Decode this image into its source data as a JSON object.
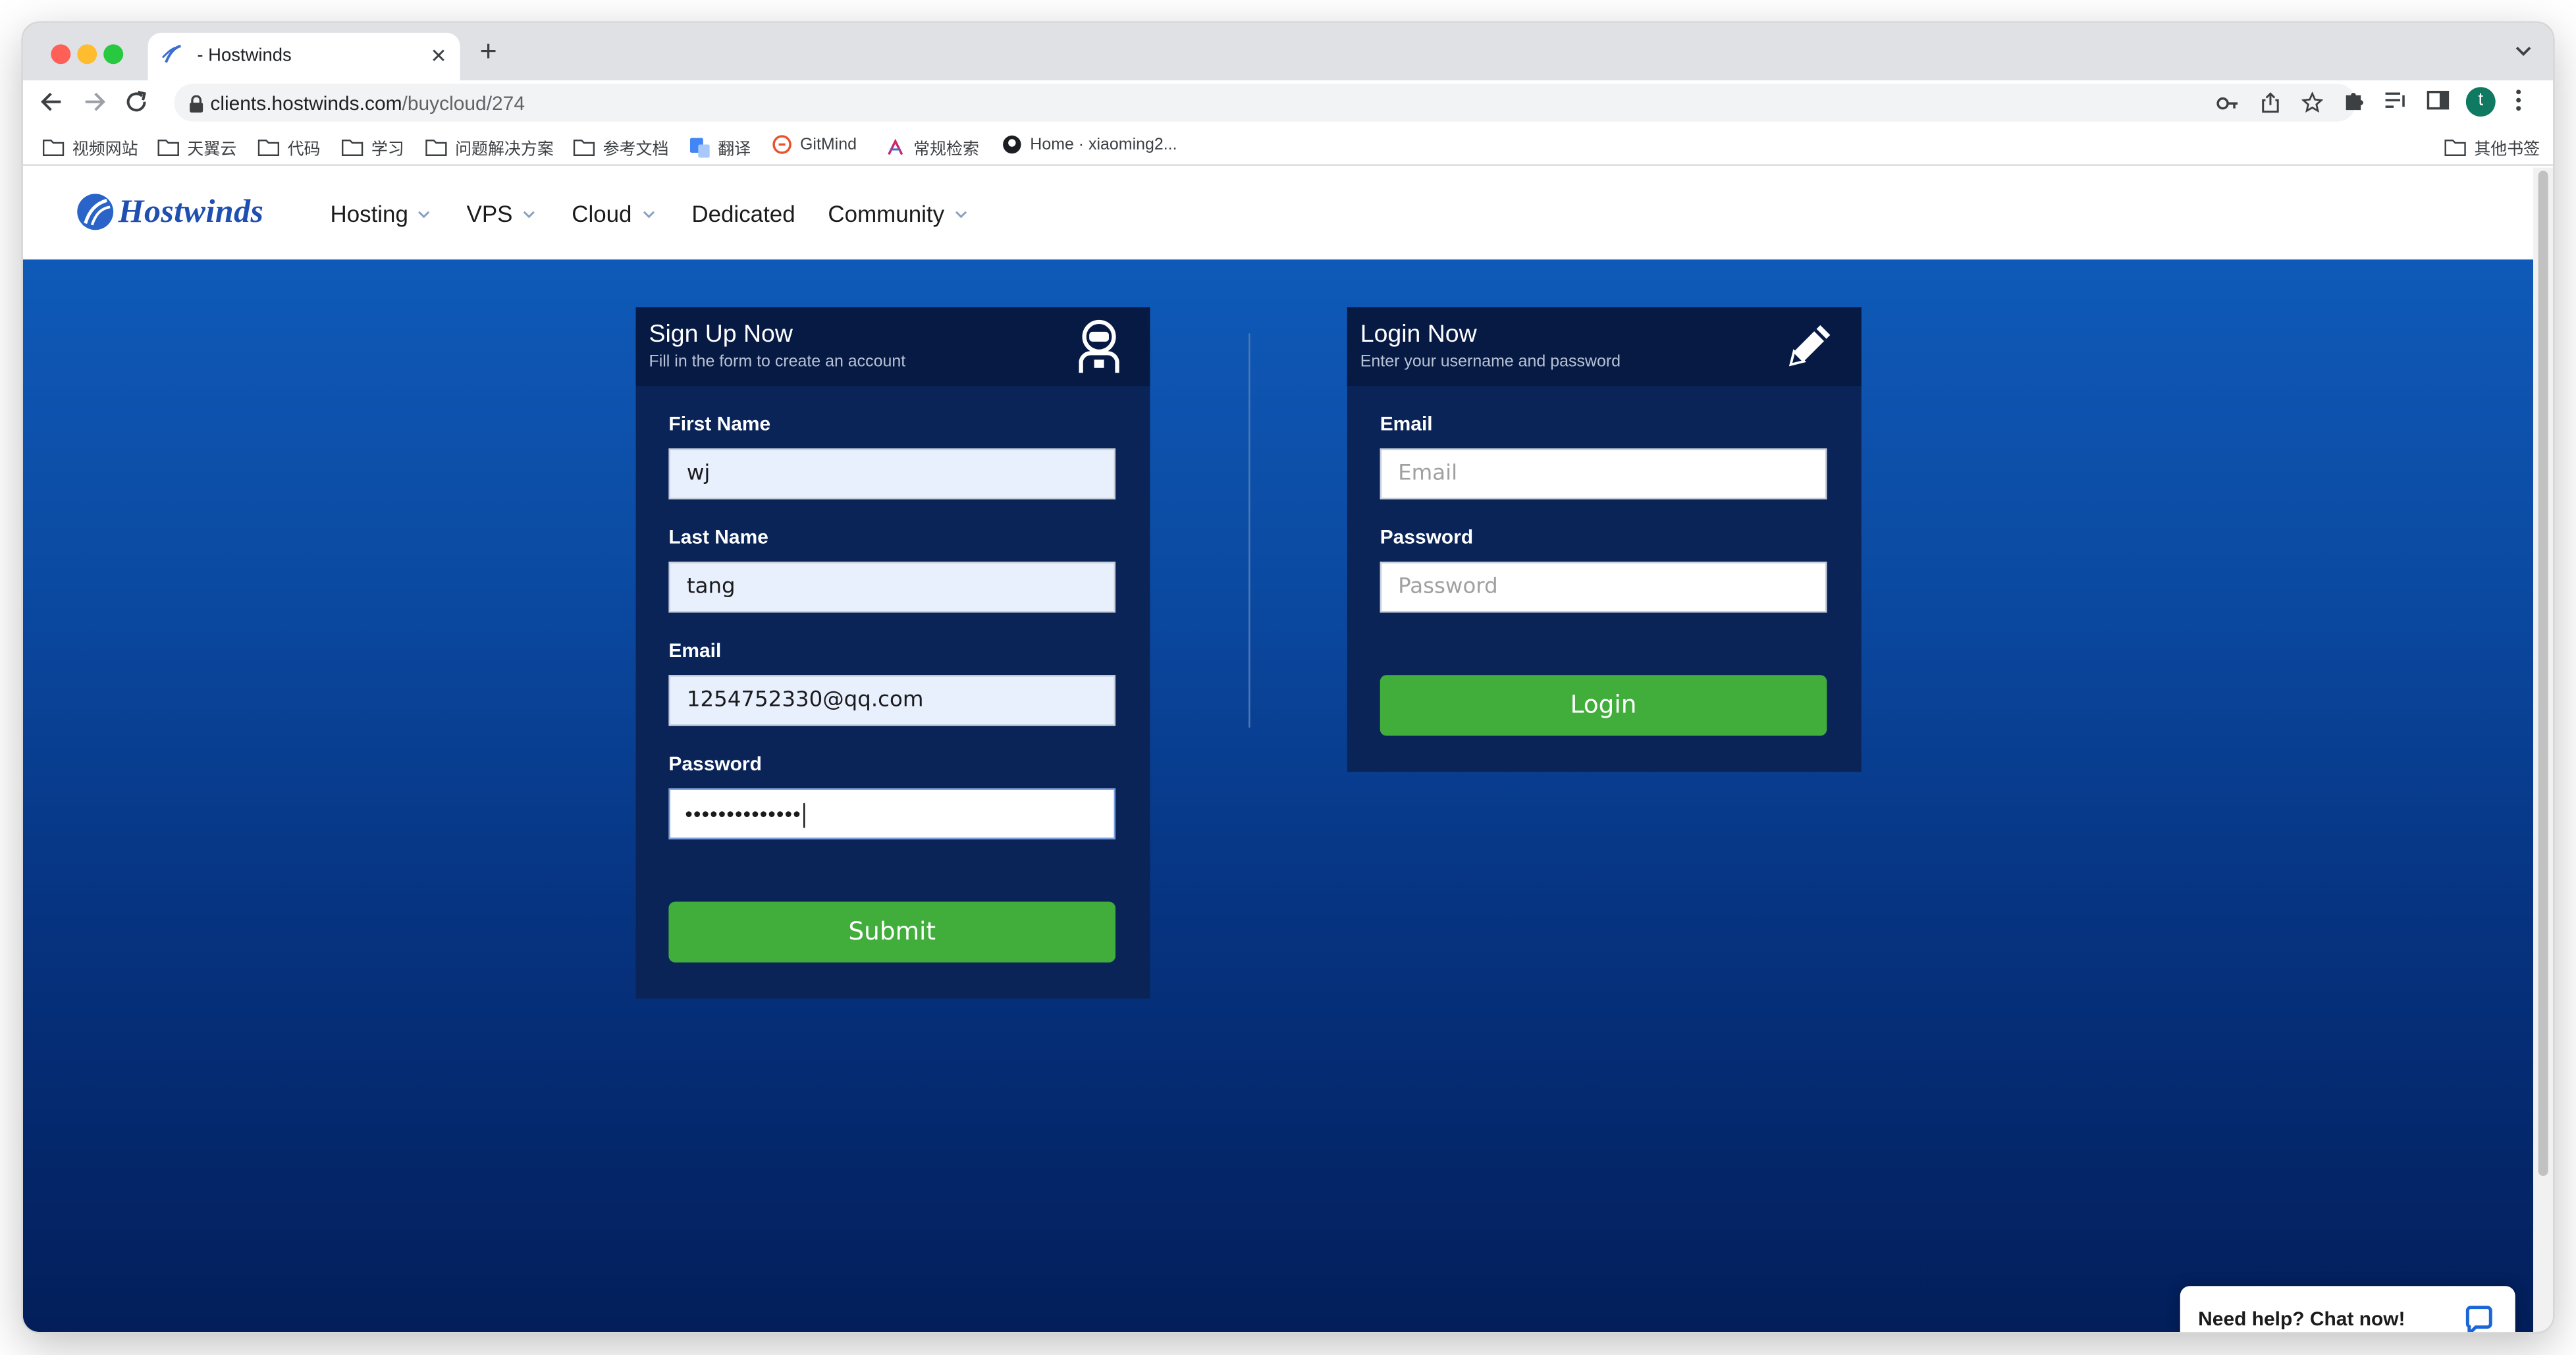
{
  "browser": {
    "tab_title": "- Hostwinds",
    "url_host": "clients.hostwinds.com",
    "url_path": "/buycloud/274",
    "profile_initial": "t",
    "bookmarks": [
      {
        "label": "视频网站",
        "icon": "folder-icon"
      },
      {
        "label": "天翼云",
        "icon": "folder-icon"
      },
      {
        "label": "代码",
        "icon": "folder-icon"
      },
      {
        "label": "学习",
        "icon": "folder-icon"
      },
      {
        "label": "问题解决方案",
        "icon": "folder-icon"
      },
      {
        "label": "参考文档",
        "icon": "folder-icon"
      },
      {
        "label": "翻译",
        "icon": "translate-icon"
      },
      {
        "label": "GitMind",
        "icon": "gitmind-icon"
      },
      {
        "label": "常规检索",
        "icon": "search-logo-icon"
      },
      {
        "label": "Home · xiaoming2...",
        "icon": "github-icon"
      }
    ],
    "other_bookmarks": "其他书签"
  },
  "site": {
    "logo_text": "Hostwinds",
    "nav": [
      {
        "label": "Hosting",
        "has_dropdown": true
      },
      {
        "label": "VPS",
        "has_dropdown": true
      },
      {
        "label": "Cloud",
        "has_dropdown": true
      },
      {
        "label": "Dedicated",
        "has_dropdown": false
      },
      {
        "label": "Community",
        "has_dropdown": true
      }
    ]
  },
  "signup": {
    "title": "Sign Up Now",
    "subtitle": "Fill in the form to create an account",
    "first_name_label": "First Name",
    "first_name_value": "wj",
    "last_name_label": "Last Name",
    "last_name_value": "tang",
    "email_label": "Email",
    "email_value": "1254752330@qq.com",
    "password_label": "Password",
    "password_mask": "••••••••••••••",
    "submit_label": "Submit"
  },
  "login": {
    "title": "Login Now",
    "subtitle": "Enter your username and password",
    "email_label": "Email",
    "email_placeholder": "Email",
    "password_label": "Password",
    "password_placeholder": "Password",
    "login_label": "Login"
  },
  "chat": {
    "label": "Need help? Chat now!"
  },
  "colors": {
    "accent_green": "#41ae3c",
    "card_bg": "#0a2458",
    "hero_top": "#0f5ab8",
    "hero_bottom": "#031e5a"
  }
}
